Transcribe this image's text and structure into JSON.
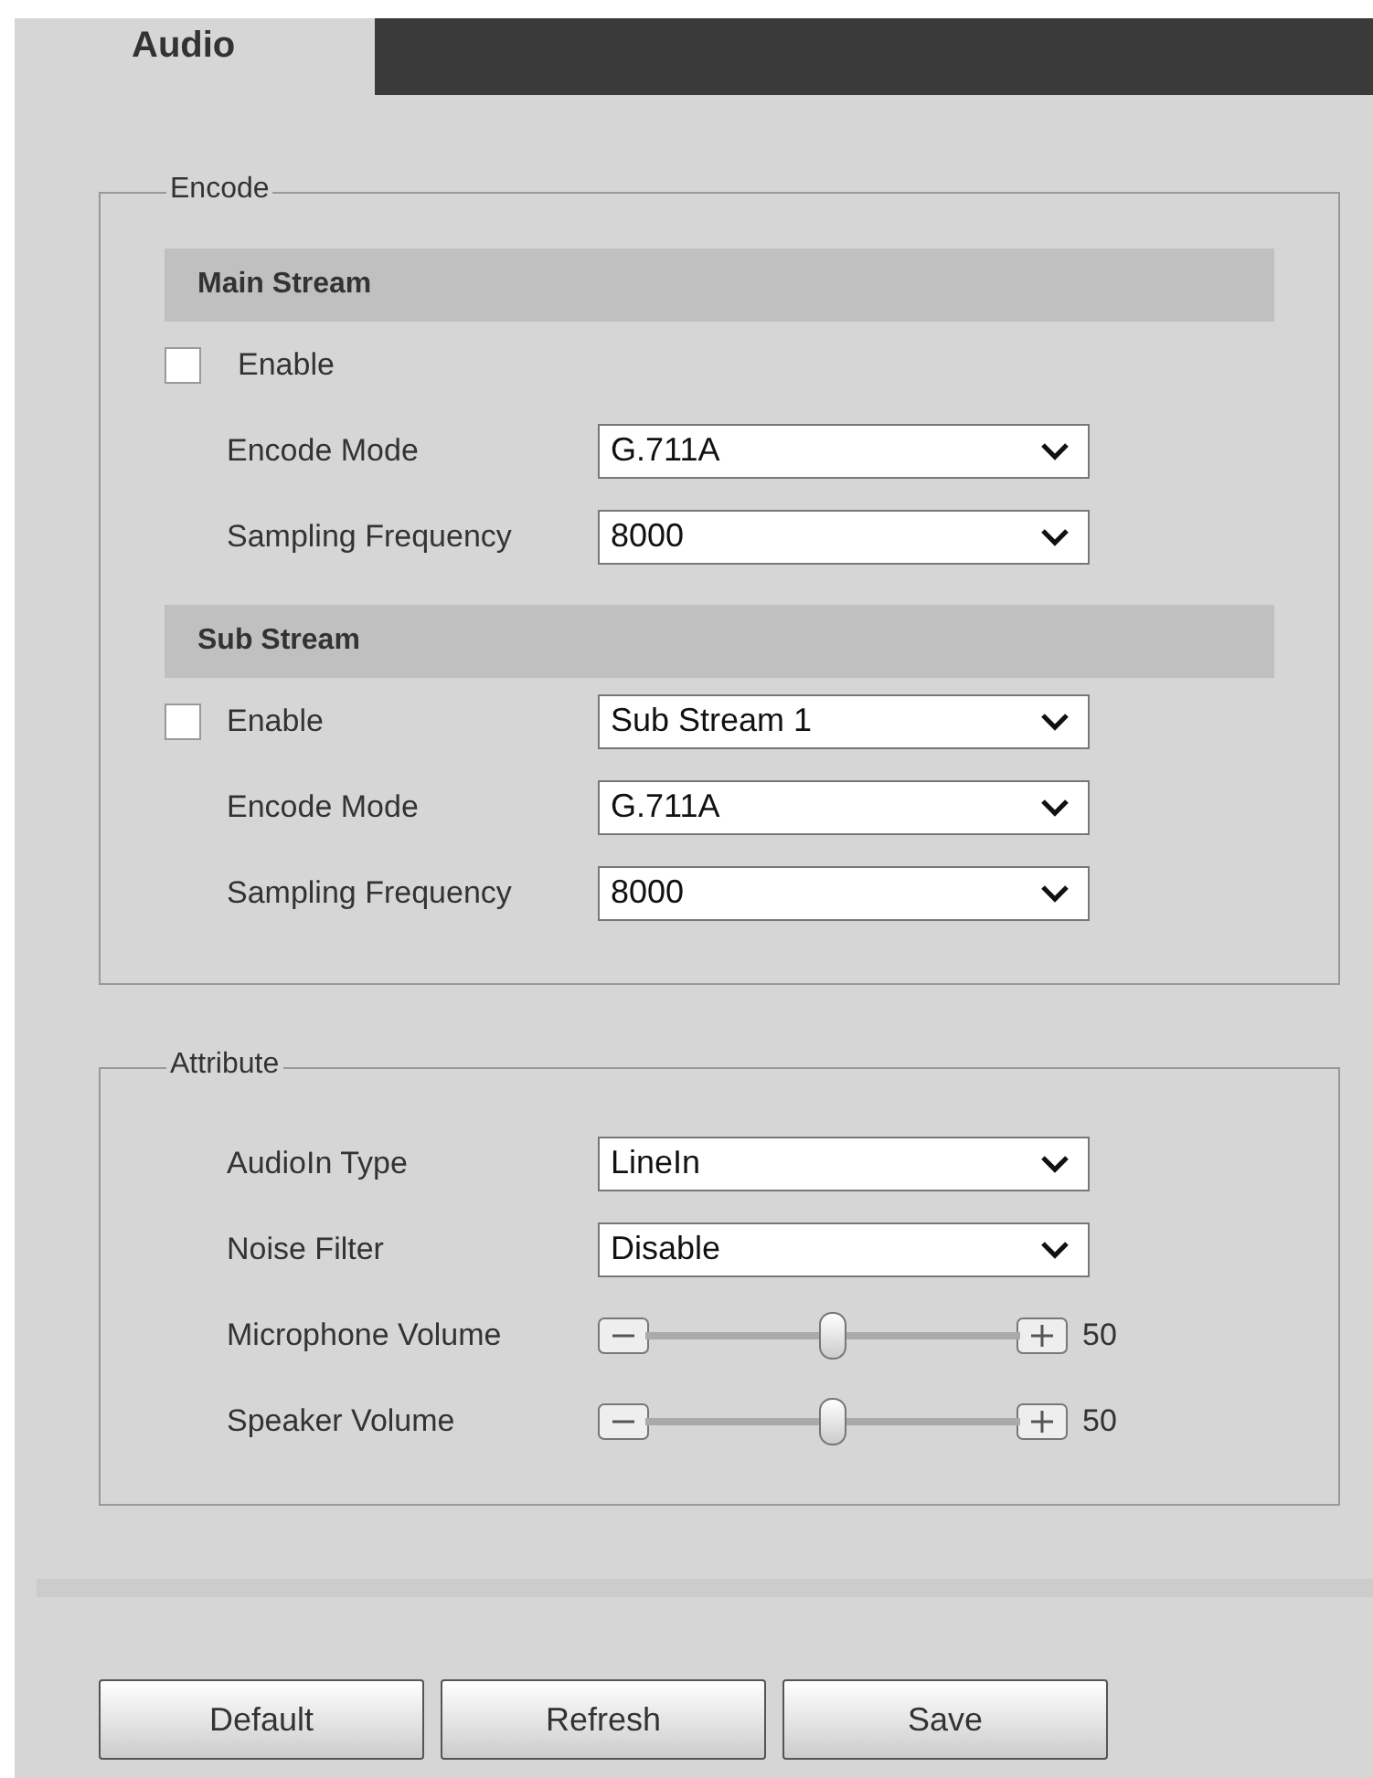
{
  "tabs": [
    {
      "label": "Audio",
      "selected": true
    }
  ],
  "encode": {
    "legend": "Encode",
    "streams": [
      {
        "title": "Main Stream",
        "enable": {
          "label": "Enable",
          "checked": false
        },
        "fields": [
          {
            "label": "Encode Mode",
            "value": "G.711A"
          },
          {
            "label": "Sampling Frequency",
            "value": "8000"
          }
        ]
      },
      {
        "title": "Sub Stream",
        "enable": {
          "label": "Enable",
          "checked": false
        },
        "selector": "Sub Stream 1",
        "fields": [
          {
            "label": "Encode Mode",
            "value": "G.711A"
          },
          {
            "label": "Sampling Frequency",
            "value": "8000"
          }
        ]
      }
    ]
  },
  "attribute": {
    "legend": "Attribute",
    "fields": [
      {
        "kind": "select",
        "label": "AudioIn Type",
        "value": "LineIn"
      },
      {
        "kind": "select",
        "label": "Noise Filter",
        "value": "Disable"
      },
      {
        "kind": "slider",
        "label": "Microphone Volume",
        "level": 0.5,
        "reading": "50"
      },
      {
        "kind": "slider",
        "label": "Speaker Volume",
        "level": 0.5,
        "reading": "50"
      }
    ]
  },
  "buttons": [
    "Default",
    "Refresh",
    "Save"
  ]
}
